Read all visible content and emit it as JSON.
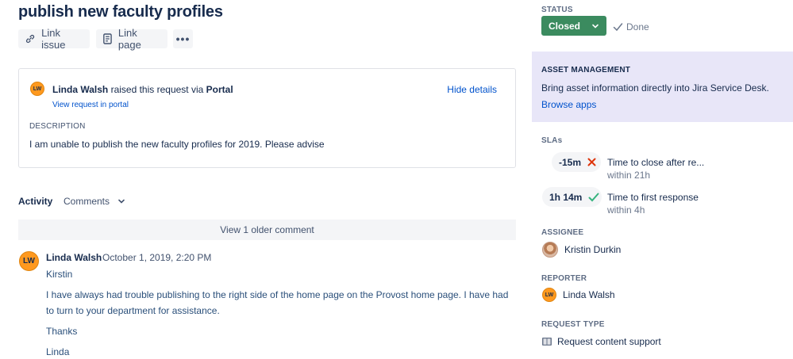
{
  "issue": {
    "title": "publish new faculty profiles"
  },
  "actions": {
    "link_issue": "Link issue",
    "link_page": "Link page",
    "more": "•••"
  },
  "request": {
    "avatar_initials": "LW",
    "reporter_name": "Linda Walsh",
    "raised_text": " raised this request via ",
    "channel": "Portal",
    "view_portal": "View request in portal",
    "hide_details": "Hide details",
    "description_label": "DESCRIPTION",
    "description": "I am unable to publish the new faculty profiles for 2019.  Please advise"
  },
  "activity": {
    "label": "Activity",
    "filter": "Comments",
    "older_comments": "View 1 older comment"
  },
  "comment": {
    "avatar_initials": "LW",
    "author": "Linda Walsh",
    "date": "October 1, 2019, 2:20 PM",
    "paragraphs": [
      "Kirstin",
      "I have always had trouble publishing to the right side of the home page on the Provost home page. I have had to turn to your department for assistance.",
      "Thanks",
      "Linda"
    ]
  },
  "sidebar": {
    "status_label": "STATUS",
    "status_value": "Closed",
    "resolution": "Done",
    "asset": {
      "title": "ASSET MANAGEMENT",
      "text": "Bring asset information directly into Jira Service Desk.",
      "link": "Browse apps"
    },
    "slas_label": "SLAs",
    "slas": [
      {
        "value": "-15m",
        "state": "breached",
        "title": "Time to close after re...",
        "sub": "within 21h"
      },
      {
        "value": "1h 14m",
        "state": "met",
        "title": "Time to first response",
        "sub": "within 4h"
      }
    ],
    "assignee_label": "ASSIGNEE",
    "assignee": "Kristin Durkin",
    "reporter_label": "REPORTER",
    "reporter_initials": "LW",
    "reporter": "Linda Walsh",
    "request_type_label": "REQUEST TYPE",
    "request_type": "Request content support"
  },
  "colors": {
    "status_green": "#3b8b5f",
    "link_blue": "#0052cc",
    "asset_bg": "#e8e6f8",
    "avatar_orange": "#ff991f",
    "sla_breached": "#de350b",
    "sla_met": "#36b37e"
  }
}
